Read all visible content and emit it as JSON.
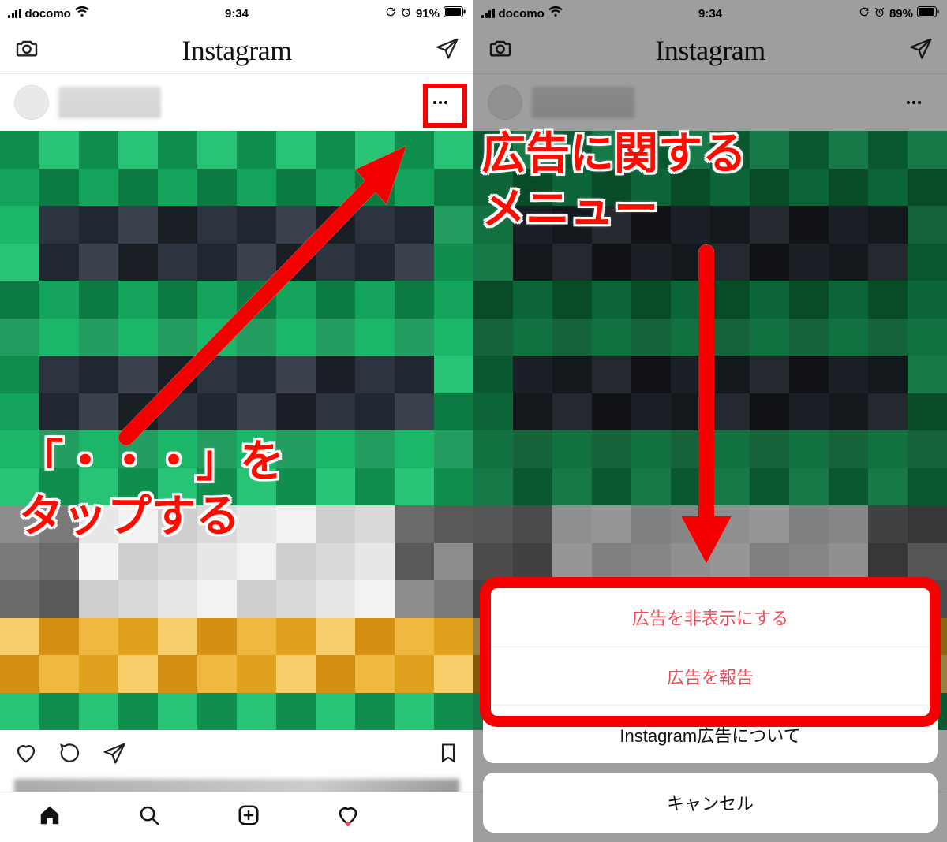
{
  "left": {
    "status": {
      "carrier": "docomo",
      "time": "9:34",
      "battery": "91%"
    },
    "header": {
      "logo": "Instagram"
    },
    "annotation": "「・・・」を\nタップする"
  },
  "right": {
    "status": {
      "carrier": "docomo",
      "time": "9:34",
      "battery": "89%"
    },
    "header": {
      "logo": "Instagram"
    },
    "annotation": "広告に関する\nメニュー",
    "sheet": {
      "hide_ad": "広告を非表示にする",
      "report_ad": "広告を報告",
      "about_ads": "Instagram広告について",
      "cancel": "キャンセル"
    }
  },
  "colors": {
    "annotation_red": "#ff0c00",
    "highlight_red": "#f40000",
    "destructive": "#ed4956"
  }
}
